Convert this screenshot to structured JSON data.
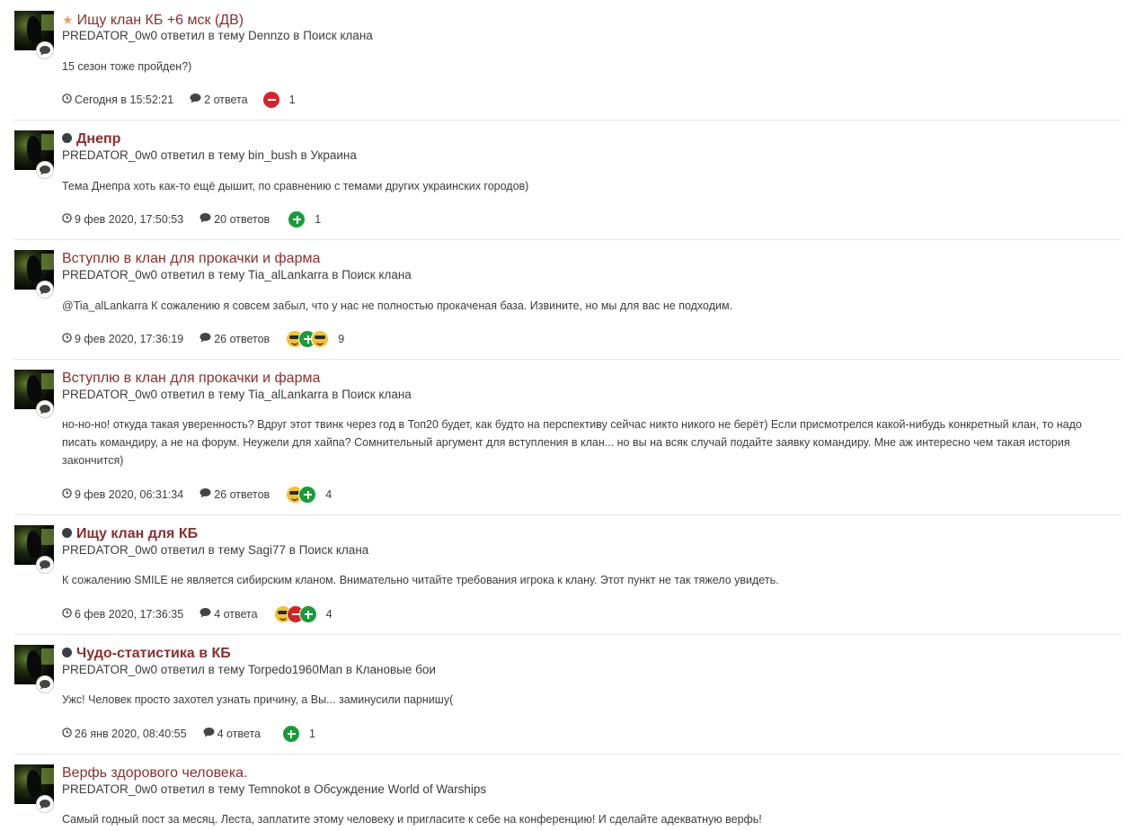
{
  "posts": [
    {
      "title_prefix": "star",
      "title": "Ищу клан КБ +6 мск (ДВ)",
      "bold": false,
      "meta": "PREDATOR_0w0 ответил в тему Dennzo в Поиск клана",
      "excerpt": "15 сезон тоже пройден?)",
      "date": "Сегодня в 15:52:21",
      "replies": "2 ответа",
      "reactions": [
        "minus"
      ],
      "reaction_count": "1"
    },
    {
      "title_prefix": "dot",
      "title": "Днепр",
      "bold": true,
      "meta": "PREDATOR_0w0 ответил в тему bin_bush в Украина",
      "excerpt": "Тема Днепра хоть как-то ещё дышит, по сравнению с темами других украинских городов)",
      "date": "9 фев 2020, 17:50:53",
      "replies": "20 ответов",
      "reactions": [
        "plus"
      ],
      "reaction_count": "1"
    },
    {
      "title_prefix": "",
      "title": "Вступлю в клан для прокачки и фарма",
      "bold": false,
      "meta": "PREDATOR_0w0 ответил в тему Tia_alLankarra в Поиск клана",
      "excerpt": "@Tia_alLankarra К сожалению я совсем забыл, что у нас не полностью прокаченая база. Извините, но мы для вас не подходим.",
      "date": "9 фев 2020, 17:36:19",
      "replies": "26 ответов",
      "reactions": [
        "smile",
        "plus",
        "smile"
      ],
      "reaction_count": "9"
    },
    {
      "title_prefix": "",
      "title": "Вступлю в клан для прокачки и фарма",
      "bold": false,
      "meta": "PREDATOR_0w0 ответил в тему Tia_alLankarra в Поиск клана",
      "excerpt": "но-но-но! откуда такая уверенность? Вдруг этот твинк через год в Топ20 будет, как будто на перспективу сейчас никто никого не берёт) Если присмотрелся какой-нибудь конкретный клан, то надо писать командиру, а не на форум. Неужели для хайпа? Сомнительный аргумент для вступления в клан... но вы на всяк случай подайте заявку командиру. Мне аж интересно чем такая история закончится)",
      "date": "9 фев 2020, 06:31:34",
      "replies": "26 ответов",
      "reactions": [
        "smile",
        "plus"
      ],
      "reaction_count": "4"
    },
    {
      "title_prefix": "dot",
      "title": "Ищу клан для КБ",
      "bold": true,
      "meta": "PREDATOR_0w0 ответил в тему Sagi77 в Поиск клана",
      "excerpt": "К сожалению SMILE не является сибирским кланом. Внимательно читайте требования игрока к клану. Этот пункт не так тяжело увидеть.",
      "date": "6 фев 2020, 17:36:35",
      "replies": "4 ответа",
      "reactions": [
        "smile",
        "minus",
        "plus"
      ],
      "reaction_count": "4"
    },
    {
      "title_prefix": "dot",
      "title": "Чудо-статистика в КБ",
      "bold": true,
      "meta": "PREDATOR_0w0 ответил в тему Torpedo1960Man в Клановые бои",
      "excerpt": "Ужс! Человек просто захотел узнать причину, а Вы... заминусили парнишу(",
      "date": "26 янв 2020, 08:40:55",
      "replies": "4 ответа",
      "reactions": [
        "plus"
      ],
      "reaction_count": "1"
    },
    {
      "title_prefix": "",
      "title": "Верфь здорового человека.",
      "bold": false,
      "meta": "PREDATOR_0w0 ответил в тему Temnokot в Обсуждение World of Warships",
      "excerpt": "Самый годный пост за месяц. Леста, заплатите этому человеку и пригласите к себе на конференцию! И сделайте адекватную верфь!",
      "date": "",
      "replies": "",
      "reactions": [],
      "reaction_count": ""
    }
  ]
}
